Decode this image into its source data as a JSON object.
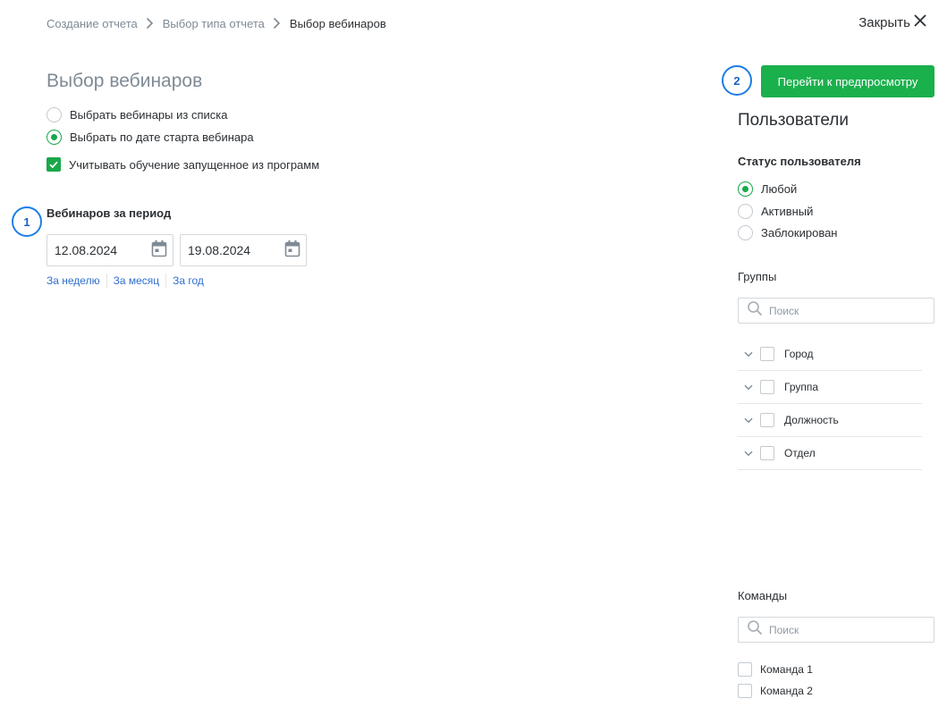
{
  "breadcrumb": {
    "items": [
      "Создание отчета",
      "Выбор типа отчета",
      "Выбор вебинаров"
    ]
  },
  "close": {
    "label": "Закрыть"
  },
  "page": {
    "title": "Выбор вебинаров",
    "selection_options": [
      {
        "label": "Выбрать вебинары из списка",
        "checked": false
      },
      {
        "label": "Выбрать по дате старта вебинара",
        "checked": true
      }
    ],
    "include_programs": {
      "label": "Учитывать обучение запущенное из программ",
      "checked": true
    }
  },
  "period": {
    "label": "Вебинаров за период",
    "date_from": "12.08.2024",
    "date_to": "19.08.2024",
    "quick_links": [
      "За неделю",
      "За месяц",
      "За год"
    ]
  },
  "badges": {
    "first": "1",
    "second": "2"
  },
  "actions": {
    "preview_label": "Перейти к предпросмотру"
  },
  "users": {
    "title": "Пользователи",
    "status_label": "Статус пользователя",
    "statuses": [
      {
        "label": "Любой",
        "checked": true
      },
      {
        "label": "Активный",
        "checked": false
      },
      {
        "label": "Заблокирован",
        "checked": false
      }
    ],
    "groups_label": "Группы",
    "groups_search_placeholder": "Поиск",
    "groups": [
      "Город",
      "Группа",
      "Должность",
      "Отдел"
    ],
    "teams_label": "Команды",
    "teams_search_placeholder": "Поиск",
    "teams": [
      "Команда 1",
      "Команда 2"
    ]
  },
  "colors": {
    "accent_green": "#1ab04c",
    "link_blue": "#2f6fcf",
    "badge_blue": "#1b7ee8",
    "muted_text": "#7f8a95"
  }
}
